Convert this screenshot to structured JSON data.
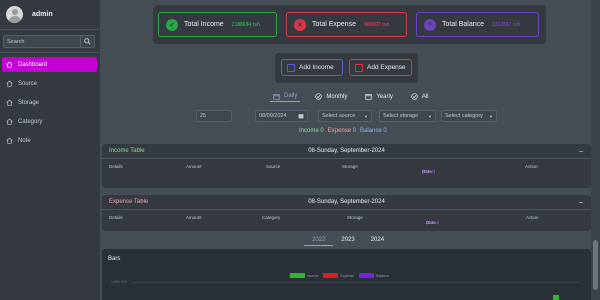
{
  "user": {
    "name": "admin"
  },
  "search": {
    "placeholder": "Search"
  },
  "menu": [
    {
      "label": "Dashboard",
      "icon": "home-icon",
      "active": true
    },
    {
      "label": "Source",
      "icon": "home-icon"
    },
    {
      "label": "Storage",
      "icon": "home-icon"
    },
    {
      "label": "Category",
      "icon": "home-icon"
    },
    {
      "label": "Note",
      "icon": "home-icon"
    }
  ],
  "summary": {
    "income": {
      "label": "Total Income",
      "value": "2188694 tsh",
      "color": "#28a745"
    },
    "expense": {
      "label": "Total Expense",
      "value": "966007 tsh",
      "color": "#dc3545"
    },
    "balance": {
      "label": "Total Balance",
      "value": "1222687 tsh",
      "color": "#6f42c1"
    }
  },
  "actions": {
    "add_income": "Add Income",
    "add_expense": "Add Expense"
  },
  "periods": [
    {
      "label": "Daily",
      "icon": "calendar-icon",
      "active": true
    },
    {
      "label": "Monthly",
      "icon": "check-circle-icon"
    },
    {
      "label": "Yearly",
      "icon": "calendar-icon"
    },
    {
      "label": "All",
      "icon": "check-circle-icon"
    }
  ],
  "filters": {
    "count": "25",
    "date": "08/09/2024",
    "source": "Select source",
    "storage": "Select storage",
    "category": "Select category"
  },
  "totals": {
    "income": "Income 0",
    "expense": "Expense 0",
    "balance": "Balance 0"
  },
  "income_table": {
    "title": "Income Table",
    "date": "08-Sunday, September-2024",
    "columns": [
      "Details",
      "Amount",
      "Source",
      "Storage",
      "Date",
      "(Desc)",
      "Action"
    ]
  },
  "expense_table": {
    "title": "Expense Table",
    "date": "08-Sunday, September-2024",
    "columns": [
      "Details",
      "Amount",
      "Category",
      "Storage",
      "Date",
      "(Desc)",
      "Action"
    ]
  },
  "years": [
    {
      "label": "2022",
      "active": true
    },
    {
      "label": "2023"
    },
    {
      "label": "2024"
    }
  ],
  "chart_data": {
    "type": "bar",
    "title": "Bars",
    "series": [
      {
        "name": "Income",
        "color": "#2eb82e"
      },
      {
        "name": "Expense",
        "color": "#dc1f1f"
      },
      {
        "name": "Balance",
        "color": "#7a1fe0"
      }
    ],
    "yticks": [
      "1,000,000"
    ]
  }
}
